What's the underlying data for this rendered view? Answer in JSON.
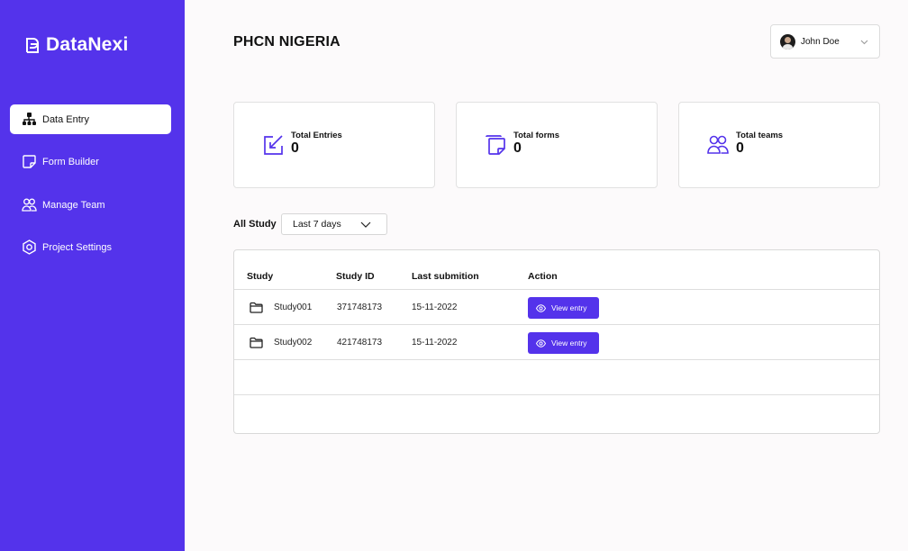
{
  "app": {
    "logo_text": "DataNexi"
  },
  "sidebar": {
    "items": [
      {
        "label": "Data Entry",
        "icon": "hierarchy-icon",
        "active": true
      },
      {
        "label": "Form Builder",
        "icon": "form-icon",
        "active": false
      },
      {
        "label": "Manage Team",
        "icon": "team-icon",
        "active": false
      },
      {
        "label": "Project Settings",
        "icon": "settings-icon",
        "active": false
      }
    ]
  },
  "header": {
    "title": "PHCN NIGERIA",
    "user_name": "John Doe"
  },
  "stats": [
    {
      "label": "Total Entries",
      "value": "0",
      "icon": "edit-entry-icon"
    },
    {
      "label": "Total forms",
      "value": "0",
      "icon": "forms-icon"
    },
    {
      "label": "Total teams",
      "value": "0",
      "icon": "teams-icon"
    }
  ],
  "filter": {
    "label": "All Study",
    "selected": "Last 7 days"
  },
  "table": {
    "headers": [
      "Study",
      "Study ID",
      "Last submition",
      "Action"
    ],
    "rows": [
      {
        "study": "Study001",
        "study_id": "371748173",
        "last_submission": "15-11-2022",
        "action": "View entry"
      },
      {
        "study": "Study002",
        "study_id": "421748173",
        "last_submission": "15-11-2022",
        "action": "View entry"
      }
    ]
  },
  "colors": {
    "brand": "#5433eb",
    "background": "#fcfafb",
    "card": "#ffffff"
  }
}
